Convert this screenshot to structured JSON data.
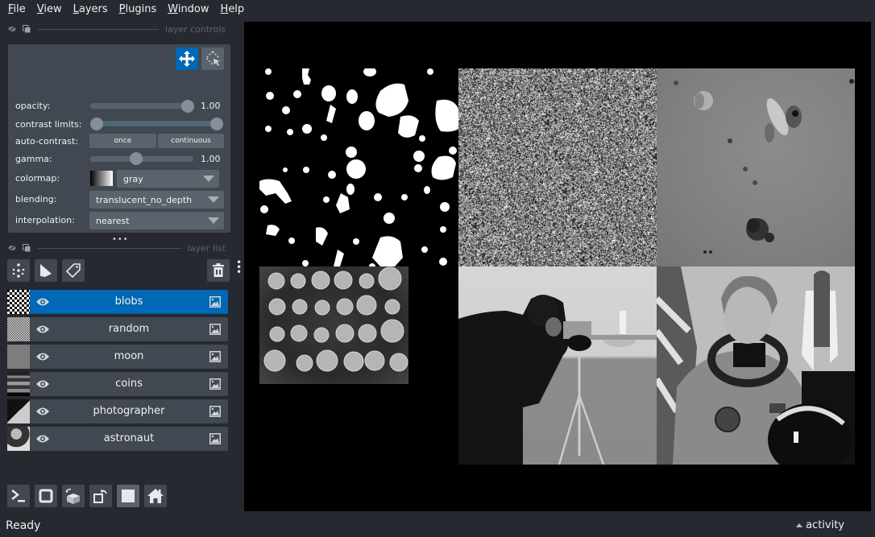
{
  "menubar": {
    "items": [
      {
        "label": "File",
        "mnemonic": "F",
        "rest": "ile"
      },
      {
        "label": "View",
        "mnemonic": "V",
        "rest": "iew"
      },
      {
        "label": "Layers",
        "mnemonic": "L",
        "rest": "ayers"
      },
      {
        "label": "Plugins",
        "mnemonic": "P",
        "rest": "lugins"
      },
      {
        "label": "Window",
        "mnemonic": "W",
        "rest": "indow"
      },
      {
        "label": "Help",
        "mnemonic": "H",
        "rest": "elp"
      }
    ]
  },
  "layer_controls": {
    "title": "layer controls",
    "opacity": {
      "label": "opacity:",
      "value": "1.00",
      "fraction": 1.0
    },
    "contrast_limits": {
      "label": "contrast limits:",
      "low_fraction": 0.0,
      "high_fraction": 1.0
    },
    "auto_contrast": {
      "label": "auto-contrast:",
      "once": "once",
      "continuous": "continuous"
    },
    "gamma": {
      "label": "gamma:",
      "value": "1.00",
      "fraction": 0.5
    },
    "colormap": {
      "label": "colormap:",
      "value": "gray"
    },
    "blending": {
      "label": "blending:",
      "value": "translucent_no_depth"
    },
    "interpolation": {
      "label": "interpolation:",
      "value": "nearest"
    }
  },
  "layer_list": {
    "title": "layer list",
    "layers": [
      {
        "name": "blobs",
        "selected": true,
        "visible": true,
        "type": "image"
      },
      {
        "name": "random",
        "selected": false,
        "visible": true,
        "type": "image"
      },
      {
        "name": "moon",
        "selected": false,
        "visible": true,
        "type": "image"
      },
      {
        "name": "coins",
        "selected": false,
        "visible": true,
        "type": "image"
      },
      {
        "name": "photographer",
        "selected": false,
        "visible": true,
        "type": "image"
      },
      {
        "name": "astronaut",
        "selected": false,
        "visible": true,
        "type": "image"
      }
    ]
  },
  "colors": {
    "accent": "#0068b4",
    "panel": "#414851",
    "background": "#262930"
  },
  "status": {
    "text": "Ready",
    "activity": "activity"
  }
}
